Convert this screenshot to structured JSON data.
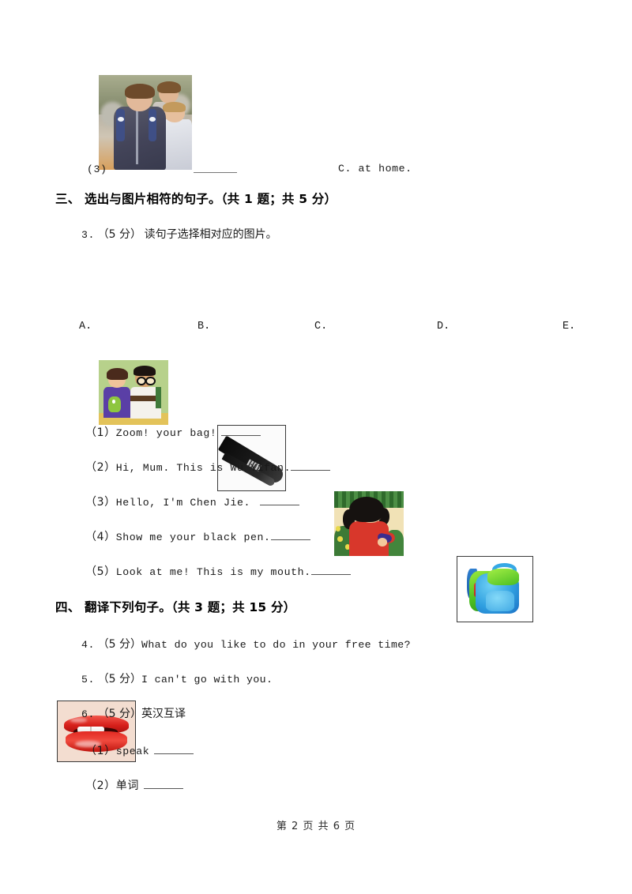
{
  "document": {
    "footer": "第 2 页 共 6 页"
  },
  "top_fragment": {
    "item_number": "(3)",
    "blank": "",
    "option_c": "C.  at home.",
    "image_alt": "photo-three-boys-with-backpacks"
  },
  "section_three": {
    "heading": "三、 选出与图片相符的句子。（共 1 题；共 5 分）",
    "question": {
      "number": "3.",
      "score": "（5 分）",
      "prompt": "读句子选择相对应的图片。"
    },
    "options": [
      {
        "letter": "A.",
        "image": "cartoon-two-boys"
      },
      {
        "letter": "B.",
        "image": "black-pen-nib"
      },
      {
        "letter": "C.",
        "image": "cartoon-girl-in-red"
      },
      {
        "letter": "D.",
        "image": "green-blue-backpack"
      },
      {
        "letter": "E.",
        "image": "red-lips-mouth"
      }
    ],
    "items": [
      {
        "number": "（1）",
        "text": "Zoom! your bag!"
      },
      {
        "number": "（2）",
        "text": "Hi, Mum. This is Wu Yifan."
      },
      {
        "number": "（3）",
        "text": "Hello, I'm Chen Jie."
      },
      {
        "number": "（4）",
        "text": "Show me your black pen."
      },
      {
        "number": "（5）",
        "text": "Look at me! This is my mouth."
      }
    ]
  },
  "section_four": {
    "heading": "四、 翻译下列句子。（共 3 题；共 15 分）",
    "questions": [
      {
        "number": "4.",
        "score": "（5 分）",
        "text": "What do you like to do in your free time?"
      },
      {
        "number": "5.",
        "score": "（5 分）",
        "text": "I can't go with you."
      },
      {
        "number": "6.",
        "score": "（5 分）",
        "text": "英汉互译"
      }
    ],
    "subitems": [
      {
        "number": "（1）",
        "text": "speak"
      },
      {
        "number": "（2）",
        "text": "单词"
      }
    ]
  }
}
